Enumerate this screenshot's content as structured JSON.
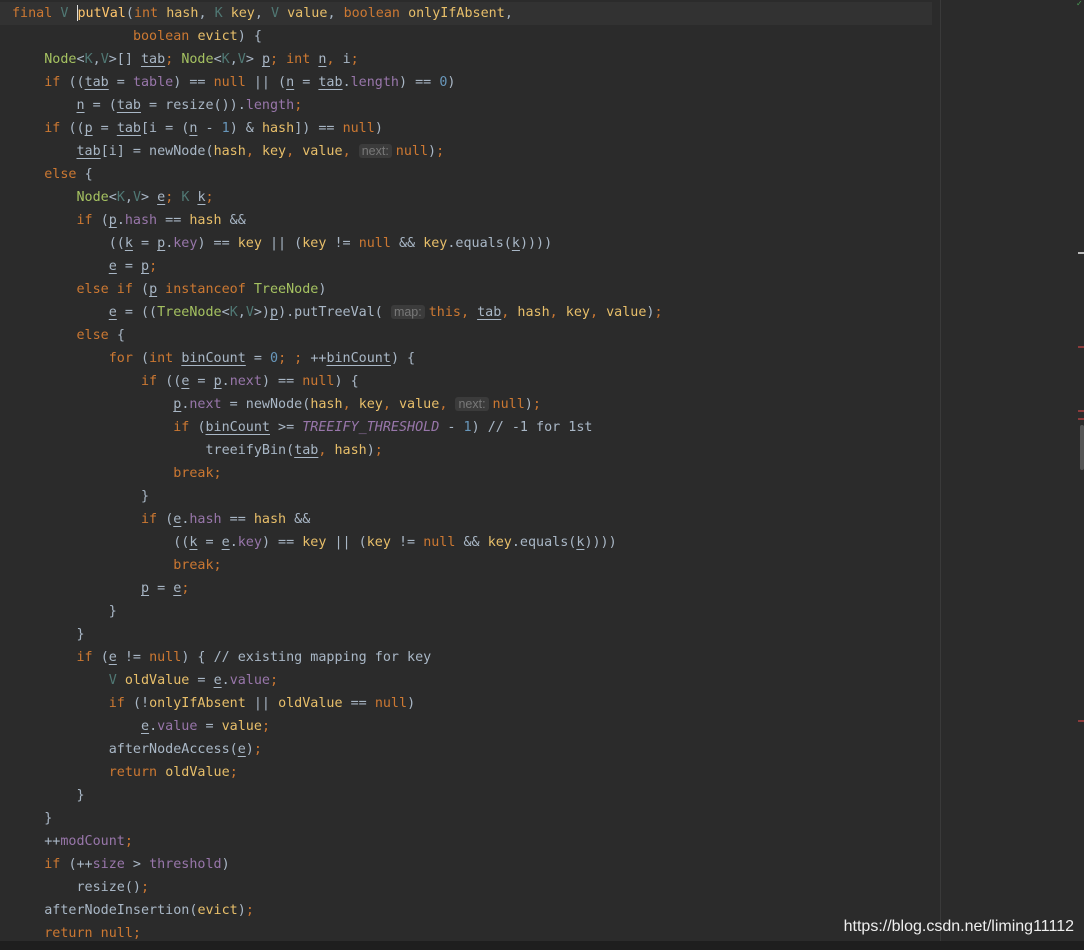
{
  "watermark": "https://blog.csdn.net/liming11112",
  "colors": {
    "background": "#2b2b2b",
    "keyword": "#cc7832",
    "function": "#ffc66d",
    "field": "#9876aa",
    "number": "#6897bb",
    "type_param": "#507874",
    "hint": "#787878"
  },
  "lines": [
    [
      [
        "kw",
        "final "
      ],
      [
        "tp",
        "V "
      ],
      [
        "caret",
        ""
      ],
      [
        "fn",
        "putVal"
      ],
      [
        "plain",
        "("
      ],
      [
        "kw",
        "int "
      ],
      [
        "param",
        "hash"
      ],
      [
        "plain",
        ", "
      ],
      [
        "tp",
        "K "
      ],
      [
        "param",
        "key"
      ],
      [
        "plain",
        ", "
      ],
      [
        "tp",
        "V "
      ],
      [
        "param",
        "value"
      ],
      [
        "plain",
        ", "
      ],
      [
        "kw",
        "boolean "
      ],
      [
        "param",
        "onlyIfAbsent"
      ],
      [
        "plain",
        ","
      ]
    ],
    [
      [
        "plain",
        "               "
      ],
      [
        "kw",
        "boolean "
      ],
      [
        "param",
        "evict"
      ],
      [
        "plain",
        ") {"
      ]
    ],
    [
      [
        "plain",
        "    "
      ],
      [
        "cls2",
        "Node"
      ],
      [
        "plain",
        "<"
      ],
      [
        "tp",
        "K"
      ],
      [
        "plain",
        ","
      ],
      [
        "tp",
        "V"
      ],
      [
        "plain",
        ">[] "
      ],
      [
        "var",
        "tab"
      ],
      [
        "kw",
        "; "
      ],
      [
        "cls2",
        "Node"
      ],
      [
        "plain",
        "<"
      ],
      [
        "tp",
        "K"
      ],
      [
        "plain",
        ","
      ],
      [
        "tp",
        "V"
      ],
      [
        "plain",
        "> "
      ],
      [
        "var",
        "p"
      ],
      [
        "kw",
        "; "
      ],
      [
        "kw",
        "int "
      ],
      [
        "var",
        "n"
      ],
      [
        "kw",
        ", "
      ],
      [
        "plain",
        "i"
      ],
      [
        "kw",
        ";"
      ]
    ],
    [
      [
        "plain",
        "    "
      ],
      [
        "kw",
        "if "
      ],
      [
        "plain",
        "(("
      ],
      [
        "var",
        "tab"
      ],
      [
        "plain",
        " = "
      ],
      [
        "field",
        "table"
      ],
      [
        "plain",
        ") == "
      ],
      [
        "kw",
        "null "
      ],
      [
        "plain",
        "|| ("
      ],
      [
        "var",
        "n"
      ],
      [
        "plain",
        " = "
      ],
      [
        "var",
        "tab"
      ],
      [
        "plain",
        "."
      ],
      [
        "field",
        "length"
      ],
      [
        "plain",
        ") == "
      ],
      [
        "num",
        "0"
      ],
      [
        "plain",
        ")"
      ]
    ],
    [
      [
        "plain",
        "        "
      ],
      [
        "var",
        "n"
      ],
      [
        "plain",
        " = ("
      ],
      [
        "var",
        "tab"
      ],
      [
        "plain",
        " = resize())."
      ],
      [
        "field",
        "length"
      ],
      [
        "kw",
        ";"
      ]
    ],
    [
      [
        "plain",
        "    "
      ],
      [
        "kw",
        "if "
      ],
      [
        "plain",
        "(("
      ],
      [
        "var",
        "p"
      ],
      [
        "plain",
        " = "
      ],
      [
        "var",
        "tab"
      ],
      [
        "plain",
        "[i = ("
      ],
      [
        "var",
        "n"
      ],
      [
        "plain",
        " - "
      ],
      [
        "num",
        "1"
      ],
      [
        "plain",
        ") & "
      ],
      [
        "param",
        "hash"
      ],
      [
        "plain",
        "]) == "
      ],
      [
        "kw",
        "null"
      ],
      [
        "plain",
        ")"
      ]
    ],
    [
      [
        "plain",
        "        "
      ],
      [
        "var",
        "tab"
      ],
      [
        "plain",
        "[i] = newNode("
      ],
      [
        "param",
        "hash"
      ],
      [
        "kw",
        ", "
      ],
      [
        "param",
        "key"
      ],
      [
        "kw",
        ", "
      ],
      [
        "param",
        "value"
      ],
      [
        "kw",
        ", "
      ],
      [
        "hint",
        "next:"
      ],
      [
        "kw",
        "null"
      ],
      [
        "plain",
        ")"
      ],
      [
        "kw",
        ";"
      ]
    ],
    [
      [
        "plain",
        "    "
      ],
      [
        "kw",
        "else "
      ],
      [
        "plain",
        "{"
      ]
    ],
    [
      [
        "plain",
        "        "
      ],
      [
        "cls2",
        "Node"
      ],
      [
        "plain",
        "<"
      ],
      [
        "tp",
        "K"
      ],
      [
        "plain",
        ","
      ],
      [
        "tp",
        "V"
      ],
      [
        "plain",
        "> "
      ],
      [
        "var",
        "e"
      ],
      [
        "kw",
        "; "
      ],
      [
        "tp",
        "K "
      ],
      [
        "var",
        "k"
      ],
      [
        "kw",
        ";"
      ]
    ],
    [
      [
        "plain",
        "        "
      ],
      [
        "kw",
        "if "
      ],
      [
        "plain",
        "("
      ],
      [
        "var",
        "p"
      ],
      [
        "plain",
        "."
      ],
      [
        "field",
        "hash"
      ],
      [
        "plain",
        " == "
      ],
      [
        "param",
        "hash"
      ],
      [
        "plain",
        " &&"
      ]
    ],
    [
      [
        "plain",
        "            (("
      ],
      [
        "var",
        "k"
      ],
      [
        "plain",
        " = "
      ],
      [
        "var",
        "p"
      ],
      [
        "plain",
        "."
      ],
      [
        "field",
        "key"
      ],
      [
        "plain",
        ") == "
      ],
      [
        "param",
        "key"
      ],
      [
        "plain",
        " || ("
      ],
      [
        "param",
        "key"
      ],
      [
        "plain",
        " != "
      ],
      [
        "kw",
        "null "
      ],
      [
        "plain",
        "&& "
      ],
      [
        "param",
        "key"
      ],
      [
        "plain",
        ".equals("
      ],
      [
        "var",
        "k"
      ],
      [
        "plain",
        "))))"
      ]
    ],
    [
      [
        "plain",
        "            "
      ],
      [
        "var",
        "e"
      ],
      [
        "plain",
        " = "
      ],
      [
        "var",
        "p"
      ],
      [
        "kw",
        ";"
      ]
    ],
    [
      [
        "plain",
        "        "
      ],
      [
        "kw",
        "else if "
      ],
      [
        "plain",
        "("
      ],
      [
        "var",
        "p"
      ],
      [
        "kw",
        " instanceof "
      ],
      [
        "cls2",
        "TreeNode"
      ],
      [
        "plain",
        ")"
      ]
    ],
    [
      [
        "plain",
        "            "
      ],
      [
        "var",
        "e"
      ],
      [
        "plain",
        " = (("
      ],
      [
        "cls2",
        "TreeNode"
      ],
      [
        "plain",
        "<"
      ],
      [
        "tp",
        "K"
      ],
      [
        "plain",
        ","
      ],
      [
        "tp",
        "V"
      ],
      [
        "plain",
        ">)"
      ],
      [
        "var",
        "p"
      ],
      [
        "plain",
        ").putTreeVal( "
      ],
      [
        "hint",
        "map:"
      ],
      [
        "kw",
        "this"
      ],
      [
        "kw",
        ", "
      ],
      [
        "var",
        "tab"
      ],
      [
        "kw",
        ", "
      ],
      [
        "param",
        "hash"
      ],
      [
        "kw",
        ", "
      ],
      [
        "param",
        "key"
      ],
      [
        "kw",
        ", "
      ],
      [
        "param",
        "value"
      ],
      [
        "plain",
        ")"
      ],
      [
        "kw",
        ";"
      ]
    ],
    [
      [
        "plain",
        "        "
      ],
      [
        "kw",
        "else "
      ],
      [
        "plain",
        "{"
      ]
    ],
    [
      [
        "plain",
        "            "
      ],
      [
        "kw",
        "for "
      ],
      [
        "plain",
        "("
      ],
      [
        "kw",
        "int "
      ],
      [
        "var",
        "binCount"
      ],
      [
        "plain",
        " = "
      ],
      [
        "num",
        "0"
      ],
      [
        "kw",
        "; ; "
      ],
      [
        "plain",
        "++"
      ],
      [
        "var",
        "binCount"
      ],
      [
        "plain",
        ") {"
      ]
    ],
    [
      [
        "plain",
        "                "
      ],
      [
        "kw",
        "if "
      ],
      [
        "plain",
        "(("
      ],
      [
        "var",
        "e"
      ],
      [
        "plain",
        " = "
      ],
      [
        "var",
        "p"
      ],
      [
        "plain",
        "."
      ],
      [
        "field",
        "next"
      ],
      [
        "plain",
        ") == "
      ],
      [
        "kw",
        "null"
      ],
      [
        "plain",
        ") {"
      ]
    ],
    [
      [
        "plain",
        "                    "
      ],
      [
        "var",
        "p"
      ],
      [
        "plain",
        "."
      ],
      [
        "field",
        "next"
      ],
      [
        "plain",
        " = newNode("
      ],
      [
        "param",
        "hash"
      ],
      [
        "kw",
        ", "
      ],
      [
        "param",
        "key"
      ],
      [
        "kw",
        ", "
      ],
      [
        "param",
        "value"
      ],
      [
        "kw",
        ", "
      ],
      [
        "hint",
        "next:"
      ],
      [
        "kw",
        "null"
      ],
      [
        "plain",
        ")"
      ],
      [
        "kw",
        ";"
      ]
    ],
    [
      [
        "plain",
        "                    "
      ],
      [
        "kw",
        "if "
      ],
      [
        "plain",
        "("
      ],
      [
        "var",
        "binCount"
      ],
      [
        "plain",
        " >= "
      ],
      [
        "const",
        "TREEIFY_THRESHOLD"
      ],
      [
        "plain",
        " - "
      ],
      [
        "num",
        "1"
      ],
      [
        "plain",
        ") "
      ],
      [
        "cmt",
        "// -1 for 1st"
      ]
    ],
    [
      [
        "plain",
        "                        treeifyBin("
      ],
      [
        "var",
        "tab"
      ],
      [
        "kw",
        ", "
      ],
      [
        "param",
        "hash"
      ],
      [
        "plain",
        ")"
      ],
      [
        "kw",
        ";"
      ]
    ],
    [
      [
        "plain",
        "                    "
      ],
      [
        "kw",
        "break;"
      ]
    ],
    [
      [
        "plain",
        "                }"
      ]
    ],
    [
      [
        "plain",
        "                "
      ],
      [
        "kw",
        "if "
      ],
      [
        "plain",
        "("
      ],
      [
        "var",
        "e"
      ],
      [
        "plain",
        "."
      ],
      [
        "field",
        "hash"
      ],
      [
        "plain",
        " == "
      ],
      [
        "param",
        "hash"
      ],
      [
        "plain",
        " &&"
      ]
    ],
    [
      [
        "plain",
        "                    (("
      ],
      [
        "var",
        "k"
      ],
      [
        "plain",
        " = "
      ],
      [
        "var",
        "e"
      ],
      [
        "plain",
        "."
      ],
      [
        "field",
        "key"
      ],
      [
        "plain",
        ") == "
      ],
      [
        "param",
        "key"
      ],
      [
        "plain",
        " || ("
      ],
      [
        "param",
        "key"
      ],
      [
        "plain",
        " != "
      ],
      [
        "kw",
        "null "
      ],
      [
        "plain",
        "&& "
      ],
      [
        "param",
        "key"
      ],
      [
        "plain",
        ".equals("
      ],
      [
        "var",
        "k"
      ],
      [
        "plain",
        "))))"
      ]
    ],
    [
      [
        "plain",
        "                    "
      ],
      [
        "kw",
        "break;"
      ]
    ],
    [
      [
        "plain",
        "                "
      ],
      [
        "var",
        "p"
      ],
      [
        "plain",
        " = "
      ],
      [
        "var",
        "e"
      ],
      [
        "kw",
        ";"
      ]
    ],
    [
      [
        "plain",
        "            }"
      ]
    ],
    [
      [
        "plain",
        "        }"
      ]
    ],
    [
      [
        "plain",
        "        "
      ],
      [
        "kw",
        "if "
      ],
      [
        "plain",
        "("
      ],
      [
        "var",
        "e"
      ],
      [
        "plain",
        " != "
      ],
      [
        "kw",
        "null"
      ],
      [
        "plain",
        ") { "
      ],
      [
        "cmt",
        "// existing mapping for key"
      ]
    ],
    [
      [
        "plain",
        "            "
      ],
      [
        "tp",
        "V "
      ],
      [
        "param",
        "oldValue"
      ],
      [
        "plain",
        " = "
      ],
      [
        "var",
        "e"
      ],
      [
        "plain",
        "."
      ],
      [
        "field",
        "value"
      ],
      [
        "kw",
        ";"
      ]
    ],
    [
      [
        "plain",
        "            "
      ],
      [
        "kw",
        "if "
      ],
      [
        "plain",
        "(!"
      ],
      [
        "param",
        "onlyIfAbsent"
      ],
      [
        "plain",
        " || "
      ],
      [
        "param",
        "oldValue"
      ],
      [
        "plain",
        " == "
      ],
      [
        "kw",
        "null"
      ],
      [
        "plain",
        ")"
      ]
    ],
    [
      [
        "plain",
        "                "
      ],
      [
        "var",
        "e"
      ],
      [
        "plain",
        "."
      ],
      [
        "field",
        "value"
      ],
      [
        "plain",
        " = "
      ],
      [
        "param",
        "value"
      ],
      [
        "kw",
        ";"
      ]
    ],
    [
      [
        "plain",
        "            afterNodeAccess("
      ],
      [
        "var",
        "e"
      ],
      [
        "plain",
        ")"
      ],
      [
        "kw",
        ";"
      ]
    ],
    [
      [
        "plain",
        "            "
      ],
      [
        "kw",
        "return "
      ],
      [
        "param",
        "oldValue"
      ],
      [
        "kw",
        ";"
      ]
    ],
    [
      [
        "plain",
        "        }"
      ]
    ],
    [
      [
        "plain",
        "    }"
      ]
    ],
    [
      [
        "plain",
        "    ++"
      ],
      [
        "field",
        "modCount"
      ],
      [
        "kw",
        ";"
      ]
    ],
    [
      [
        "plain",
        "    "
      ],
      [
        "kw",
        "if "
      ],
      [
        "plain",
        "(++"
      ],
      [
        "field",
        "size"
      ],
      [
        "plain",
        " > "
      ],
      [
        "field",
        "threshold"
      ],
      [
        "plain",
        ")"
      ]
    ],
    [
      [
        "plain",
        "        resize()"
      ],
      [
        "kw",
        ";"
      ]
    ],
    [
      [
        "plain",
        "    afterNodeInsertion("
      ],
      [
        "param",
        "evict"
      ],
      [
        "plain",
        ")"
      ],
      [
        "kw",
        ";"
      ]
    ],
    [
      [
        "plain",
        "    "
      ],
      [
        "kw",
        "return null;"
      ]
    ]
  ]
}
